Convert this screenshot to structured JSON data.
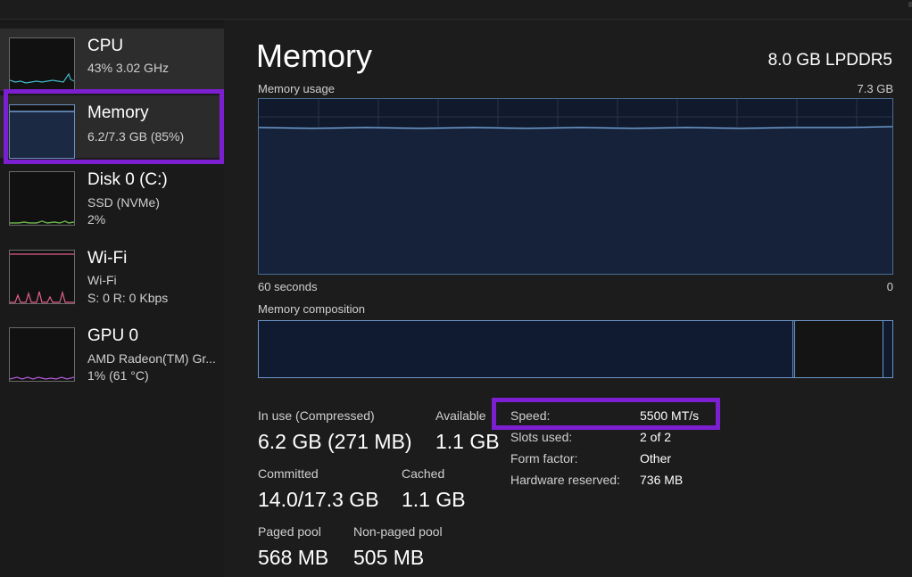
{
  "colors": {
    "background": "#1c1c1c",
    "sidebar_active": "#2d2d2d",
    "highlight": "#7c1fd1",
    "graph_fill": "#111a2c",
    "graph_line": "#7fb2e8",
    "cpu_line": "#3fb7c7",
    "disk_line": "#6ab04c",
    "wifi_line": "#e0608c",
    "gpu_line": "#b05ad8"
  },
  "sidebar": {
    "items": [
      {
        "title": "CPU",
        "line1": "43%  3.02 GHz",
        "line2": ""
      },
      {
        "title": "Memory",
        "line1": "6.2/7.3 GB (85%)",
        "line2": ""
      },
      {
        "title": "Disk 0 (C:)",
        "line1": "SSD (NVMe)",
        "line2": "2%"
      },
      {
        "title": "Wi-Fi",
        "line1": "Wi-Fi",
        "line2": "S: 0  R: 0 Kbps"
      },
      {
        "title": "GPU 0",
        "line1": "AMD Radeon(TM) Gr...",
        "line2": "1%  (61 °C)"
      }
    ]
  },
  "main": {
    "title": "Memory",
    "memory_type": "8.0 GB LPDDR5",
    "usage_label": "Memory usage",
    "usage_max": "7.3 GB",
    "time_left": "60 seconds",
    "time_right": "0",
    "usage_fraction": 0.85,
    "composition_label": "Memory composition",
    "composition": {
      "in_use_fraction": 0.847,
      "standby_fraction": 0.14
    }
  },
  "stats": {
    "in_use_label": "In use (Compressed)",
    "in_use_value": "6.2 GB (271 MB)",
    "available_label": "Available",
    "available_value": "1.1 GB",
    "committed_label": "Committed",
    "committed_value": "14.0/17.3 GB",
    "cached_label": "Cached",
    "cached_value": "1.1 GB",
    "paged_label": "Paged pool",
    "paged_value": "568 MB",
    "nonpaged_label": "Non-paged pool",
    "nonpaged_value": "505 MB"
  },
  "details": {
    "speed_label": "Speed:",
    "speed_value": "5500 MT/s",
    "slots_label": "Slots used:",
    "slots_value": "2 of 2",
    "form_label": "Form factor:",
    "form_value": "Other",
    "reserved_label": "Hardware reserved:",
    "reserved_value": "736 MB"
  }
}
